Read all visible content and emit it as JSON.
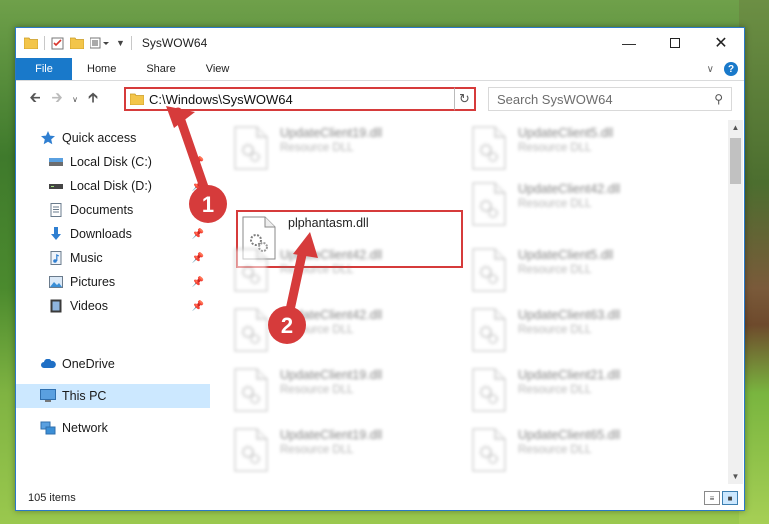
{
  "window": {
    "title": "SysWOW64"
  },
  "ribbon": {
    "tabs": [
      "File",
      "Home",
      "Share",
      "View"
    ]
  },
  "address": {
    "path": "C:\\Windows\\SysWOW64"
  },
  "search": {
    "placeholder": "Search SysWOW64"
  },
  "sidebar": {
    "items": [
      {
        "label": "Quick access",
        "icon": "star-icon",
        "pinned": false
      },
      {
        "label": "Local Disk (C:)",
        "icon": "drive-icon",
        "pinned": true
      },
      {
        "label": "Local Disk (D:)",
        "icon": "drive-icon",
        "pinned": true
      },
      {
        "label": "Documents",
        "icon": "document-icon",
        "pinned": true
      },
      {
        "label": "Downloads",
        "icon": "download-icon",
        "pinned": true
      },
      {
        "label": "Music",
        "icon": "music-icon",
        "pinned": true
      },
      {
        "label": "Pictures",
        "icon": "pictures-icon",
        "pinned": true
      },
      {
        "label": "Videos",
        "icon": "video-icon",
        "pinned": true
      },
      {
        "label": "OneDrive",
        "icon": "cloud-icon",
        "pinned": false
      },
      {
        "label": "This PC",
        "icon": "computer-icon",
        "pinned": false,
        "selected": true
      },
      {
        "label": "Network",
        "icon": "network-icon",
        "pinned": false
      }
    ]
  },
  "files": {
    "left": [
      {
        "name": "UpdateClient19.dll",
        "type": "Resource DLL"
      },
      {
        "name": "plphantasm.dll",
        "type": ""
      },
      {
        "name": "UpdateClient42.dll",
        "type": "Resource DLL"
      },
      {
        "name": "UpdateClient42.dll",
        "type": "Resource DLL"
      },
      {
        "name": "UpdateClient19.dll",
        "type": "Resource DLL"
      },
      {
        "name": "UpdateClient19.dll",
        "type": "Resource DLL"
      }
    ],
    "right": [
      {
        "name": "UpdateClient5.dll",
        "type": "Resource DLL"
      },
      {
        "name": "UpdateClient42.dll",
        "type": "Resource DLL"
      },
      {
        "name": "UpdateClient5.dll",
        "type": "Resource DLL"
      },
      {
        "name": "UpdateClient63.dll",
        "type": "Resource DLL"
      },
      {
        "name": "UpdateClient21.dll",
        "type": "Resource DLL"
      },
      {
        "name": "UpdateClient65.dll",
        "type": "Resource DLL"
      }
    ]
  },
  "status": {
    "item_count": "105 items"
  },
  "annotations": {
    "step1": "1",
    "step2": "2",
    "color": "#d63b3b"
  }
}
